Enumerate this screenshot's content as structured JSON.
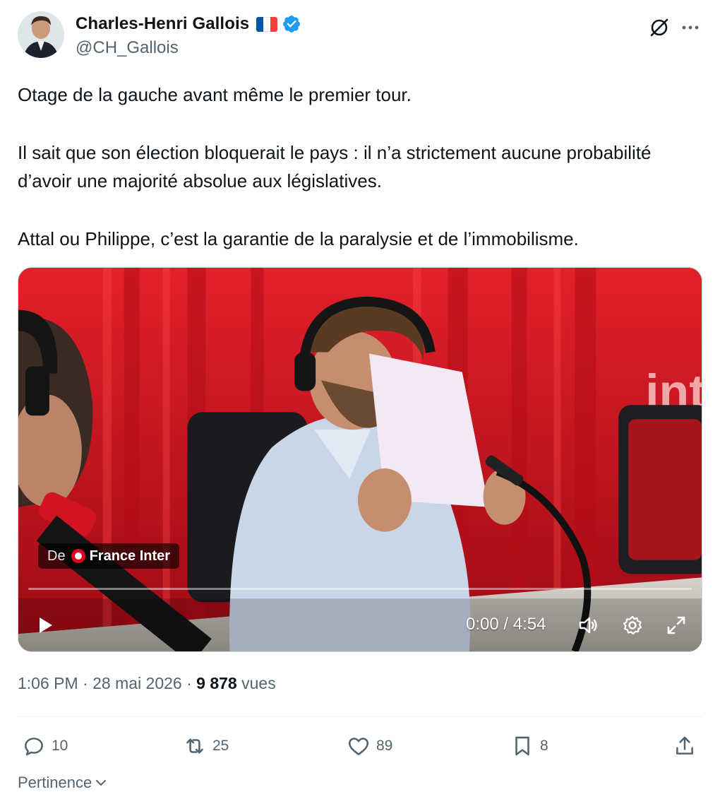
{
  "author": {
    "name": "Charles-Henri Gallois",
    "handle": "@CH_Gallois",
    "flag": "french-flag-icon",
    "verified_color": "#1d9bf0"
  },
  "header_actions": {
    "grok_icon": "grok-icon",
    "more_icon": "more-icon"
  },
  "tweet": {
    "paragraphs": [
      "Otage de la gauche avant même le premier tour.",
      "Il sait que son élection bloquerait le pays : il n’a strictement aucune probabilité d’avoir une majorité absolue aux législatives.",
      "Attal ou Philippe, c’est la garantie de la paralysie et de l’immobilisme."
    ]
  },
  "video": {
    "source_prefix": "De",
    "source_name": "France Inter",
    "time_display": "0:00 / 4:54",
    "progress": 0,
    "controls": [
      "play-icon",
      "volume-icon",
      "settings-icon",
      "fullscreen-icon"
    ]
  },
  "meta": {
    "time": "1:06 PM",
    "date": "28 mai 2026",
    "views_count": "9 878",
    "views_label": "vues",
    "separator": "·"
  },
  "actions": {
    "replies": "10",
    "reposts": "25",
    "likes": "89",
    "bookmarks": "8"
  },
  "sort": {
    "label": "Pertinence"
  },
  "colors": {
    "text": "#0f1419",
    "secondary": "#536471",
    "accent": "#1d9bf0",
    "studio_red": "#c8101c"
  }
}
